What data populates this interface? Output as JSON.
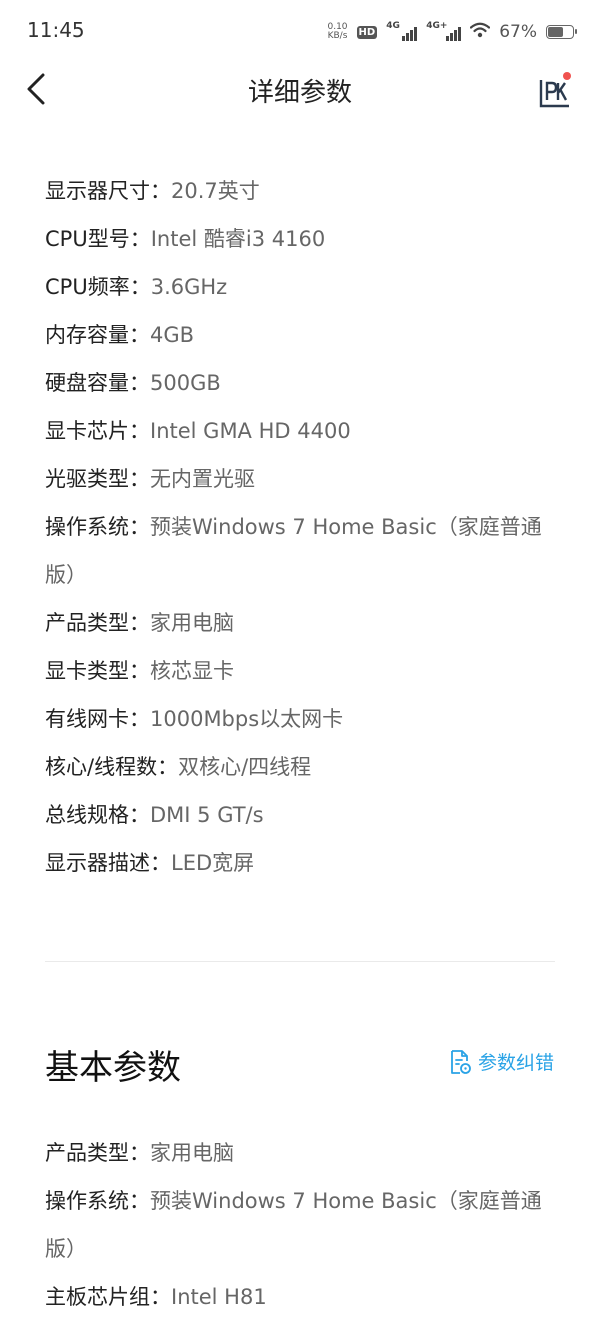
{
  "status_bar": {
    "time": "11:45",
    "net_speed_value": "0.10",
    "net_speed_unit": "KB/s",
    "hd_label": "HD",
    "sim1_label": "4G",
    "sim2_label": "4G+",
    "battery_percent": "67%",
    "battery_level": 0.67
  },
  "nav": {
    "title": "详细参数",
    "back_icon": "chevron-left-icon",
    "pk_icon": "pk-compare-icon",
    "badge_color": "#f0524f"
  },
  "details": [
    {
      "label": "显示器尺寸：",
      "value": "20.7英寸"
    },
    {
      "label": "CPU型号：",
      "value": "Intel 酷睿i3 4160"
    },
    {
      "label": "CPU频率：",
      "value": "3.6GHz"
    },
    {
      "label": "内存容量：",
      "value": "4GB"
    },
    {
      "label": "硬盘容量：",
      "value": "500GB"
    },
    {
      "label": "显卡芯片：",
      "value": "Intel GMA HD 4400"
    },
    {
      "label": "光驱类型：",
      "value": "无内置光驱"
    },
    {
      "label": "操作系统：",
      "value": "预装Windows 7 Home Basic（家庭普通版）"
    },
    {
      "label": "产品类型：",
      "value": "家用电脑"
    },
    {
      "label": "显卡类型：",
      "value": "核芯显卡"
    },
    {
      "label": "有线网卡：",
      "value": "1000Mbps以太网卡"
    },
    {
      "label": "核心/线程数：",
      "value": "双核心/四线程"
    },
    {
      "label": "总线规格：",
      "value": "DMI 5 GT/s"
    },
    {
      "label": "显示器描述：",
      "value": "LED宽屏"
    }
  ],
  "basic_section": {
    "title": "基本参数",
    "correct_label": "参数纠错",
    "correct_icon": "document-edit-icon",
    "accent_color": "#2aa3e6",
    "items": [
      {
        "label": "产品类型：",
        "value": "家用电脑"
      },
      {
        "label": "操作系统：",
        "value": "预装Windows 7 Home Basic（家庭普通版）"
      },
      {
        "label": "主板芯片组：",
        "value": "Intel H81"
      }
    ]
  }
}
